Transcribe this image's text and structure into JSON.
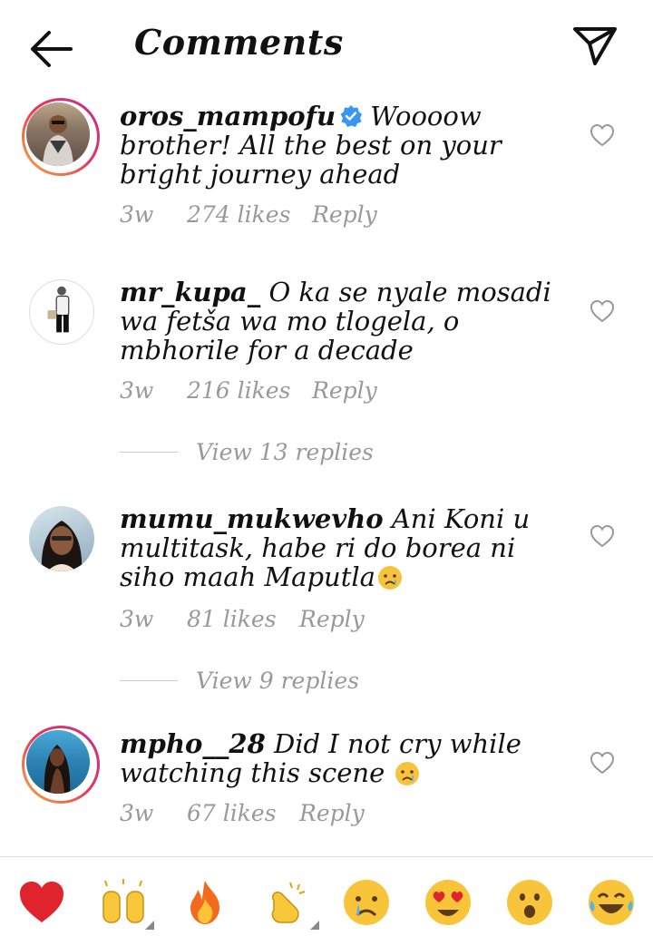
{
  "header": {
    "title": "Comments",
    "back_icon": "arrow-left-icon",
    "send_icon": "paper-plane-icon"
  },
  "comments": [
    {
      "username": "oros_mampofu",
      "verified": true,
      "text": "Woooow brother! All the best on your bright journey ahead",
      "time": "3w",
      "likes": "274 likes",
      "reply": "Reply"
    },
    {
      "username": "mr_kupa_",
      "verified": false,
      "text": "O ka se nyale mosadi wa fetša wa mo tlogela, o mbhorile for a decade",
      "time": "3w",
      "likes": "216 likes",
      "reply": "Reply",
      "view_replies": "View 13 replies"
    },
    {
      "username": "mumu_mukwevho",
      "verified": false,
      "text": "Ani Koni u multitask, habe ri do borea ni siho maah Maputla",
      "time": "3w",
      "likes": "81 likes",
      "reply": "Reply",
      "view_replies": "View 9 replies"
    },
    {
      "username": "mpho__28",
      "verified": false,
      "text": "Did I not cry while watching this scene",
      "time": "3w",
      "likes": "67 likes",
      "reply": "Reply"
    }
  ],
  "emoji_bar": [
    "red-heart",
    "raising-hands",
    "fire",
    "clapping-hands",
    "crying-face",
    "heart-eyes-face",
    "astonished-face",
    "tears-of-joy-face"
  ],
  "colors": {
    "verified": "#3897f0",
    "ring_start": "#f6b23d",
    "ring_end": "#c22e8c",
    "meta": "#999999"
  }
}
